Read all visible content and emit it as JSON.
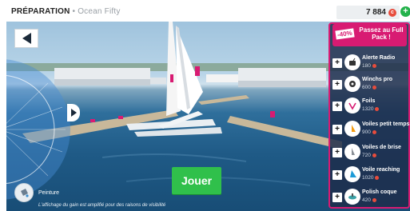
{
  "header": {
    "title": "PRÉPARATION",
    "separator": "•",
    "boat_name": "Ocean Fifty",
    "credits": "7 884",
    "currency_icon": "credit-coin-icon",
    "add_credits_icon": "plus-circle-icon"
  },
  "scene": {
    "back_icon": "back-arrow-icon",
    "play_label": "Jouer",
    "paint_label": "Peinture",
    "paint_icon": "paint-bucket-icon",
    "footnote": "L'affichage du gain est amplifié pour des raisons de visibilité"
  },
  "promo": {
    "discount": "-40%",
    "text": "Passez au Full Pack !"
  },
  "options": [
    {
      "name": "Alerte Radio",
      "price": "180",
      "icon": "radio-icon"
    },
    {
      "name": "Winchs pro",
      "price": "600",
      "icon": "winch-icon"
    },
    {
      "name": "Foils",
      "price": "1320",
      "icon": "foil-icon"
    },
    {
      "name": "Voiles petit temps",
      "price": "900",
      "icon": "light-sail-icon"
    },
    {
      "name": "Voiles de brise",
      "price": "720",
      "icon": "heavy-sail-icon"
    },
    {
      "name": "Voile reaching",
      "price": "1020",
      "icon": "reaching-sail-icon"
    },
    {
      "name": "Polish coque",
      "price": "420",
      "icon": "hull-polish-icon"
    }
  ],
  "colors": {
    "accent": "#d81b72",
    "play": "#30c04b",
    "coin": "#e74c3c"
  }
}
